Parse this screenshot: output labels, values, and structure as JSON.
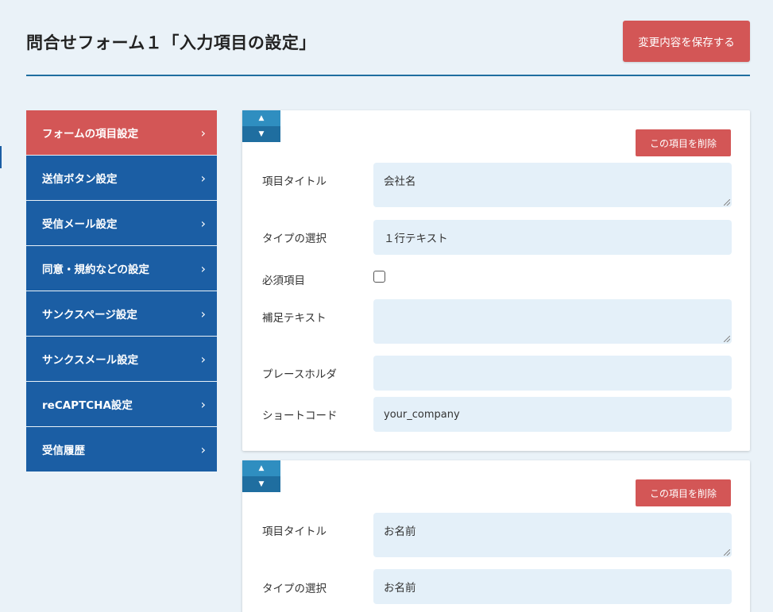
{
  "header": {
    "title": "問合せフォーム１「入力項目の設定」",
    "save_label": "変更内容を保存する"
  },
  "sidebar": {
    "items": [
      {
        "label": "フォームの項目設定",
        "active": true
      },
      {
        "label": "送信ボタン設定"
      },
      {
        "label": "受信メール設定"
      },
      {
        "label": "同意・規約などの設定"
      },
      {
        "label": "サンクスページ設定"
      },
      {
        "label": "サンクスメール設定"
      },
      {
        "label": "reCAPTCHA設定"
      },
      {
        "label": "受信履歴"
      }
    ],
    "chevron": "›"
  },
  "cards": [
    {
      "delete_label": "この項目を削除",
      "labels": {
        "title": "項目タイトル",
        "type": "タイプの選択",
        "required": "必須項目",
        "supplement": "補足テキスト",
        "placeholder": "プレースホルダ",
        "shortcode": "ショートコード"
      },
      "values": {
        "title": "会社名",
        "type": "１行テキスト",
        "required": false,
        "supplement": "",
        "placeholder": "",
        "shortcode": "your_company"
      }
    },
    {
      "delete_label": "この項目を削除",
      "labels": {
        "title": "項目タイトル",
        "type": "タイプの選択"
      },
      "values": {
        "title": "お名前",
        "type": "お名前"
      }
    }
  ],
  "arrows": {
    "up": "▲",
    "down": "▼"
  },
  "colors": {
    "accent_red": "#d35656",
    "nav_blue": "#1b5ea4",
    "field_bg": "#e4f0f9",
    "page_bg": "#eaf2f8"
  }
}
